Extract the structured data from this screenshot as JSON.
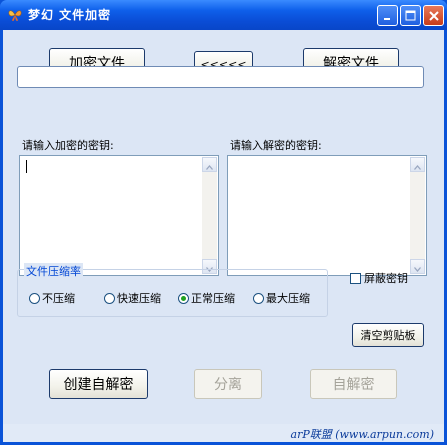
{
  "window": {
    "title": "梦幻 文件加密",
    "icons": {
      "app": "butterfly-icon",
      "minimize": "minimize-icon",
      "maximize": "maximize-icon",
      "close": "close-icon"
    }
  },
  "toolbar": {
    "encrypt_label": "加密文件",
    "back_label": "<<<<<",
    "decrypt_label": "解密文件"
  },
  "labels": {
    "encrypt_key": "请输入加密的密钥:",
    "decrypt_key": "请输入解密的密钥:"
  },
  "compression": {
    "group_title": "文件压缩率",
    "options": [
      "不压缩",
      "快速压缩",
      "正常压缩",
      "最大压缩"
    ],
    "selected": "正常压缩"
  },
  "side": {
    "hide_key_label": "屏蔽密钥",
    "clear_clipboard_label": "清空剪贴板"
  },
  "actions": {
    "create_sfx_label": "创建自解密",
    "split_label": "分离",
    "self_decrypt_label": "自解密"
  },
  "status": {
    "text": "arP联盟 (www.arpun.com)"
  },
  "colors": {
    "titlebar": "#0A4DD6",
    "client_bg": "#DCE6F5",
    "group_title": "#0046D5",
    "radio_selected": "#21A121"
  }
}
